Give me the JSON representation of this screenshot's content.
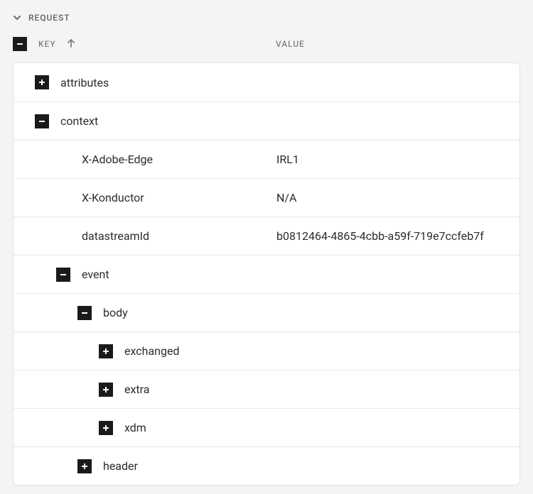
{
  "section_title": "REQUEST",
  "columns": {
    "key": "KEY",
    "value": "VALUE"
  },
  "rows": [
    {
      "indent": 0,
      "toggle": "plus",
      "key": "attributes",
      "value": ""
    },
    {
      "indent": 0,
      "toggle": "minus",
      "key": "context",
      "value": ""
    },
    {
      "indent": 1,
      "toggle": null,
      "key": "X-Adobe-Edge",
      "value": "IRL1"
    },
    {
      "indent": 1,
      "toggle": null,
      "key": "X-Konductor",
      "value": "N/A"
    },
    {
      "indent": 1,
      "toggle": null,
      "key": "datastreamId",
      "value": "b0812464-4865-4cbb-a59f-719e7ccfeb7f"
    },
    {
      "indent": 1,
      "toggle": "minus",
      "key": "event",
      "value": ""
    },
    {
      "indent": 2,
      "toggle": "minus",
      "key": "body",
      "value": ""
    },
    {
      "indent": 3,
      "toggle": "plus",
      "key": "exchanged",
      "value": ""
    },
    {
      "indent": 3,
      "toggle": "plus",
      "key": "extra",
      "value": ""
    },
    {
      "indent": 3,
      "toggle": "plus",
      "key": "xdm",
      "value": ""
    },
    {
      "indent": 2,
      "toggle": "plus",
      "key": "header",
      "value": ""
    }
  ]
}
